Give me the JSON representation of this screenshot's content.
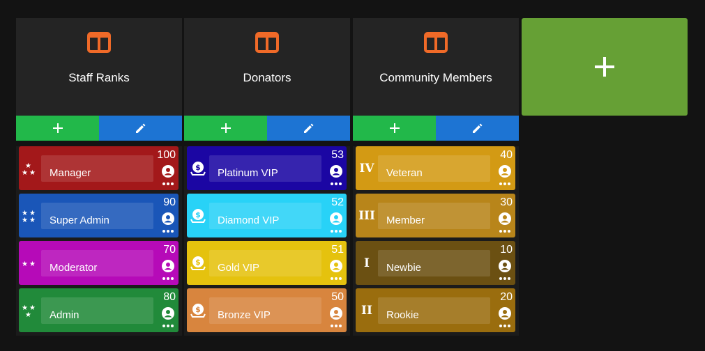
{
  "columns": [
    {
      "title": "Staff Ranks",
      "icon": "columns-icon",
      "ranks": [
        {
          "name": "Manager",
          "weight": "100",
          "color": "#a3181a",
          "icon": "stars-three-icon"
        },
        {
          "name": "Super Admin",
          "weight": "90",
          "color": "#1a56b8",
          "icon": "stars-four-icon"
        },
        {
          "name": "Moderator",
          "weight": "70",
          "color": "#b60ab8",
          "icon": "stars-two-icon"
        },
        {
          "name": "Admin",
          "weight": "80",
          "color": "#218a3a",
          "icon": "stars-three-icon"
        }
      ]
    },
    {
      "title": "Donators",
      "icon": "columns-icon",
      "ranks": [
        {
          "name": "Platinum VIP",
          "weight": "53",
          "color": "#1b06a3",
          "icon": "dollar-coin-icon"
        },
        {
          "name": "Diamond VIP",
          "weight": "52",
          "color": "#28d2f7",
          "icon": "dollar-coin-icon"
        },
        {
          "name": "Gold VIP",
          "weight": "51",
          "color": "#e5c20e",
          "icon": "dollar-coin-icon"
        },
        {
          "name": "Bronze VIP",
          "weight": "50",
          "color": "#d8853e",
          "icon": "dollar-coin-icon"
        }
      ]
    },
    {
      "title": "Community Members",
      "icon": "columns-icon",
      "ranks": [
        {
          "name": "Veteran",
          "weight": "40",
          "color": "#d39a14",
          "icon": "roman-four-icon",
          "roman": "IV"
        },
        {
          "name": "Member",
          "weight": "30",
          "color": "#b8851a",
          "icon": "roman-three-icon",
          "roman": "III"
        },
        {
          "name": "Newbie",
          "weight": "10",
          "color": "#6b5012",
          "icon": "roman-one-icon",
          "roman": "I"
        },
        {
          "name": "Rookie",
          "weight": "20",
          "color": "#9a6d0e",
          "icon": "roman-two-icon",
          "roman": "II"
        }
      ]
    }
  ],
  "colors": {
    "add_button": "#22b84a",
    "edit_button": "#1d74d3",
    "add_column": "#66a035",
    "accent_icon": "#f06a28"
  },
  "actions": {
    "add_icon": "plus-icon",
    "edit_icon": "pencil-icon",
    "add_column_icon": "plus-icon"
  }
}
